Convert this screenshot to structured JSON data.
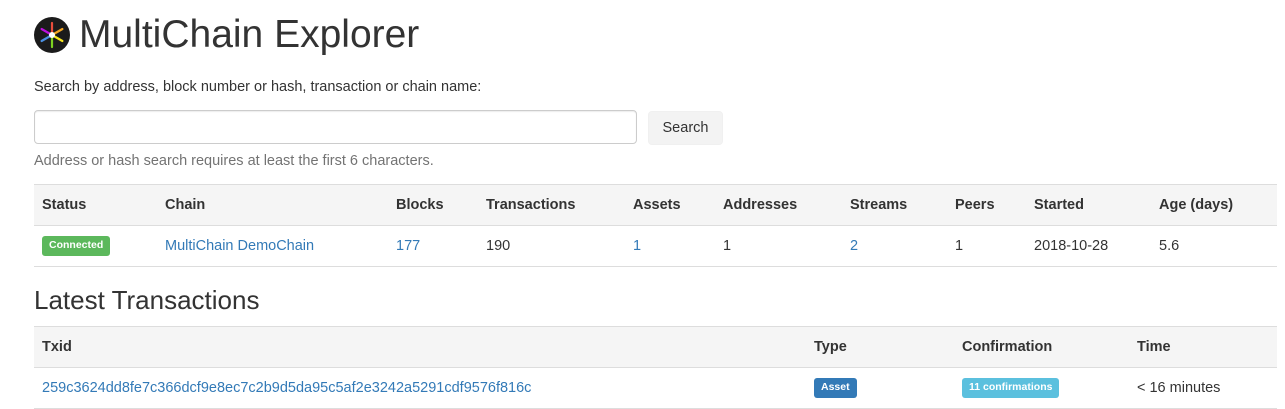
{
  "header": {
    "title": "MultiChain Explorer"
  },
  "search": {
    "label": "Search by address, block number or hash, transaction or chain name:",
    "value": "",
    "placeholder": "",
    "button_label": "Search",
    "help_text": "Address or hash search requires at least the first 6 characters."
  },
  "summary": {
    "headers": {
      "status": "Status",
      "chain": "Chain",
      "blocks": "Blocks",
      "transactions": "Transactions",
      "assets": "Assets",
      "addresses": "Addresses",
      "streams": "Streams",
      "peers": "Peers",
      "started": "Started",
      "age": "Age (days)"
    },
    "row": {
      "status": "Connected",
      "chain": "MultiChain DemoChain",
      "blocks": "177",
      "transactions": "190",
      "assets": "1",
      "addresses": "1",
      "streams": "2",
      "peers": "1",
      "started": "2018-10-28",
      "age": "5.6"
    }
  },
  "latest": {
    "title": "Latest Transactions",
    "headers": {
      "txid": "Txid",
      "type": "Type",
      "confirmation": "Confirmation",
      "time": "Time"
    },
    "rows": [
      {
        "txid": "259c3624dd8fe7c366dcf9e8ec7c2b9d5da95c5af2e3242a5291cdf9576f816c",
        "type": "Asset",
        "confirmation": "11 confirmations",
        "time": "< 16 minutes"
      }
    ]
  },
  "colors": {
    "link": "#337ab7",
    "success": "#5cb85c",
    "primary": "#337ab7",
    "info": "#5bc0de",
    "table_header_bg": "#f5f5f5"
  },
  "icons": {
    "logo": "multichain-logo-icon"
  }
}
